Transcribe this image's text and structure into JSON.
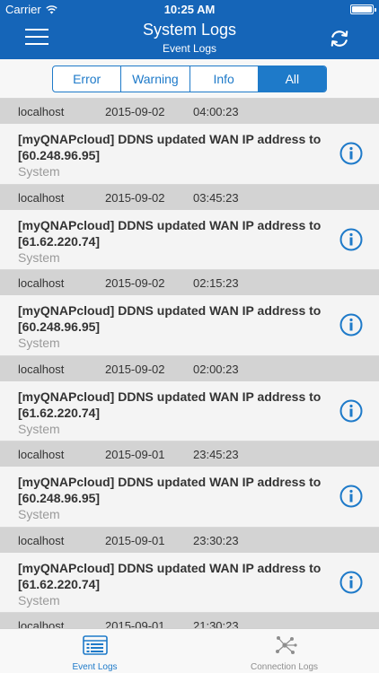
{
  "status_bar": {
    "carrier": "Carrier",
    "time": "10:25 AM"
  },
  "nav": {
    "title": "System Logs",
    "subtitle": "Event Logs",
    "menu_icon": "hamburger-menu-icon",
    "refresh_icon": "refresh-icon"
  },
  "segments": [
    {
      "label": "Error",
      "active": false
    },
    {
      "label": "Warning",
      "active": false
    },
    {
      "label": "Info",
      "active": false
    },
    {
      "label": "All",
      "active": true
    }
  ],
  "logs": [
    {
      "host": "localhost",
      "date": "2015-09-02",
      "time": "04:00:23",
      "message": "[myQNAPcloud] DDNS updated WAN IP address to [60.248.96.95]",
      "category": "System"
    },
    {
      "host": "localhost",
      "date": "2015-09-02",
      "time": "03:45:23",
      "message": "[myQNAPcloud] DDNS updated WAN IP address to [61.62.220.74]",
      "category": "System"
    },
    {
      "host": "localhost",
      "date": "2015-09-02",
      "time": "02:15:23",
      "message": "[myQNAPcloud] DDNS updated WAN IP address to [60.248.96.95]",
      "category": "System"
    },
    {
      "host": "localhost",
      "date": "2015-09-02",
      "time": "02:00:23",
      "message": "[myQNAPcloud] DDNS updated WAN IP address to [61.62.220.74]",
      "category": "System"
    },
    {
      "host": "localhost",
      "date": "2015-09-01",
      "time": "23:45:23",
      "message": "[myQNAPcloud] DDNS updated WAN IP address to [60.248.96.95]",
      "category": "System"
    },
    {
      "host": "localhost",
      "date": "2015-09-01",
      "time": "23:30:23",
      "message": "[myQNAPcloud] DDNS updated WAN IP address to [61.62.220.74]",
      "category": "System"
    },
    {
      "host": "localhost",
      "date": "2015-09-01",
      "time": "21:30:23",
      "message": "",
      "category": ""
    }
  ],
  "tabs": [
    {
      "label": "Event Logs",
      "icon": "event-logs-icon",
      "active": true
    },
    {
      "label": "Connection Logs",
      "icon": "connection-logs-icon",
      "active": false
    }
  ],
  "colors": {
    "header": "#1565b8",
    "accent": "#1e7ac9",
    "row_header": "#d3d3d3"
  }
}
